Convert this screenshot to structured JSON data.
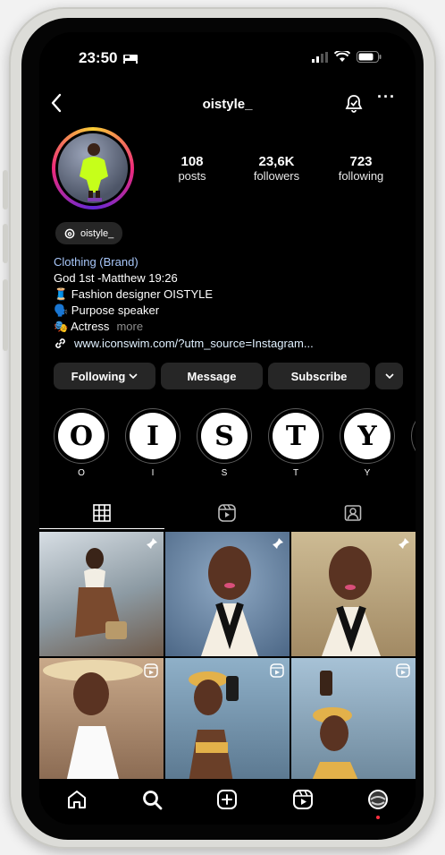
{
  "status_bar": {
    "time": "23:50"
  },
  "profile": {
    "username": "oistyle_",
    "stats": [
      {
        "value": "108",
        "label": "posts"
      },
      {
        "value": "23,6K",
        "label": "followers"
      },
      {
        "value": "723",
        "label": "following"
      }
    ],
    "threads_handle": "oistyle_",
    "bio": {
      "category": "Clothing (Brand)",
      "lines": [
        "God 1st -Matthew 19:26",
        "🧵 Fashion designer OISTYLE",
        "🗣️ Purpose speaker",
        "🎭 Actress"
      ],
      "more": "more"
    },
    "link": "www.iconswim.com/?utm_source=Instagram..."
  },
  "buttons": {
    "following": "Following",
    "message": "Message",
    "subscribe": "Subscribe"
  },
  "highlights": [
    {
      "letter": "O",
      "label": "O"
    },
    {
      "letter": "I",
      "label": "I"
    },
    {
      "letter": "S",
      "label": "S"
    },
    {
      "letter": "T",
      "label": "T"
    },
    {
      "letter": "Y",
      "label": "Y"
    }
  ],
  "tabs": [
    {
      "icon": "grid-icon"
    },
    {
      "icon": "reels-icon"
    },
    {
      "icon": "tagged-icon"
    }
  ],
  "grid_posts": [
    {
      "badge": "pin-icon"
    },
    {
      "badge": "pin-icon"
    },
    {
      "badge": "pin-icon"
    },
    {
      "badge": "reel-icon"
    },
    {
      "badge": "reel-icon"
    },
    {
      "badge": "reel-icon"
    }
  ],
  "bottom_nav": [
    {
      "icon": "home-icon"
    },
    {
      "icon": "search-icon"
    },
    {
      "icon": "create-icon"
    },
    {
      "icon": "reels-icon"
    },
    {
      "icon": "profile-avatar"
    }
  ],
  "colors": {
    "accent_link": "#a8c7fa",
    "button_bg": "#262626",
    "notification_dot": "#ff3040"
  }
}
